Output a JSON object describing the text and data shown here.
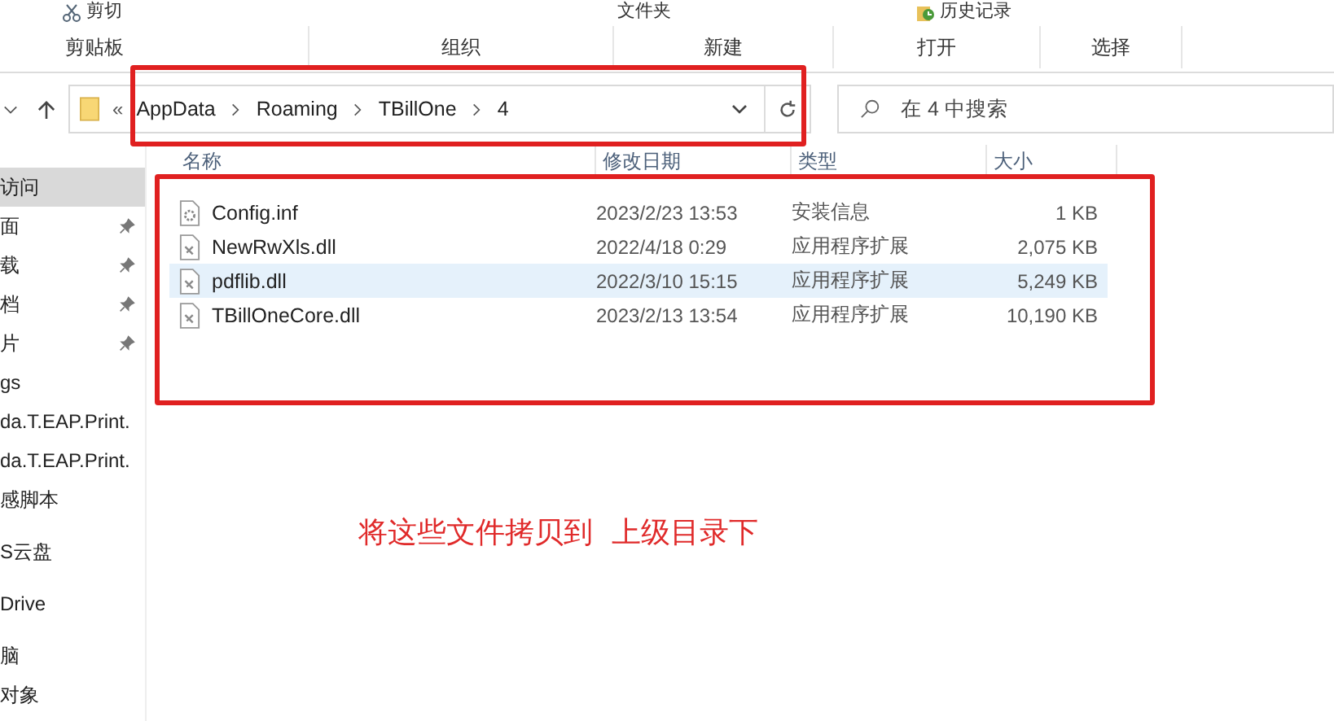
{
  "ribbon": {
    "top_items": [
      {
        "label": "剪切",
        "kind": "scissors"
      },
      {
        "label": "文件夹",
        "kind": "none"
      },
      {
        "label": "历史记录",
        "kind": "history"
      }
    ],
    "groups": [
      "剪贴板",
      "组织",
      "新建",
      "打开",
      "选择"
    ]
  },
  "address": {
    "overflow": "«",
    "crumbs": [
      "AppData",
      "Roaming",
      "TBillOne",
      "4"
    ]
  },
  "search": {
    "placeholder": "在 4 中搜索"
  },
  "sidebar": {
    "items": [
      {
        "label": "访问",
        "kind": "item",
        "pinned": false,
        "selected": true
      },
      {
        "label": "面",
        "kind": "item",
        "pinned": true,
        "selected": false
      },
      {
        "label": "载",
        "kind": "item",
        "pinned": true,
        "selected": false
      },
      {
        "label": "档",
        "kind": "item",
        "pinned": true,
        "selected": false
      },
      {
        "label": "片",
        "kind": "item",
        "pinned": true,
        "selected": false
      },
      {
        "label": "gs",
        "kind": "item",
        "pinned": false,
        "selected": false
      },
      {
        "label": "da.T.EAP.Print.",
        "kind": "item",
        "pinned": false,
        "selected": false
      },
      {
        "label": "da.T.EAP.Print.",
        "kind": "item",
        "pinned": false,
        "selected": false
      },
      {
        "label": "感脚本",
        "kind": "item",
        "pinned": false,
        "selected": false
      },
      {
        "label": "S云盘",
        "kind": "root",
        "pinned": false,
        "selected": false
      },
      {
        "label": "Drive",
        "kind": "root",
        "pinned": false,
        "selected": false
      },
      {
        "label": "脑",
        "kind": "root",
        "pinned": false,
        "selected": false
      },
      {
        "label": "对象",
        "kind": "item",
        "pinned": false,
        "selected": false
      }
    ]
  },
  "table": {
    "columns": [
      "名称",
      "修改日期",
      "类型",
      "大小"
    ],
    "rows": [
      {
        "name": "Config.inf",
        "kind": "settings",
        "date": "2023/2/23 13:53",
        "type": "安装信息",
        "size": "1 KB",
        "selected": false
      },
      {
        "name": "NewRwXls.dll",
        "kind": "dll",
        "date": "2022/4/18 0:29",
        "type": "应用程序扩展",
        "size": "2,075 KB",
        "selected": false
      },
      {
        "name": "pdflib.dll",
        "kind": "dll",
        "date": "2022/3/10 15:15",
        "type": "应用程序扩展",
        "size": "5,249 KB",
        "selected": true
      },
      {
        "name": "TBillOneCore.dll",
        "kind": "dll",
        "date": "2023/2/13 13:54",
        "type": "应用程序扩展",
        "size": "10,190 KB",
        "selected": false
      }
    ]
  },
  "annotation": {
    "text": "将这些文件拷贝到  上级目录下"
  }
}
